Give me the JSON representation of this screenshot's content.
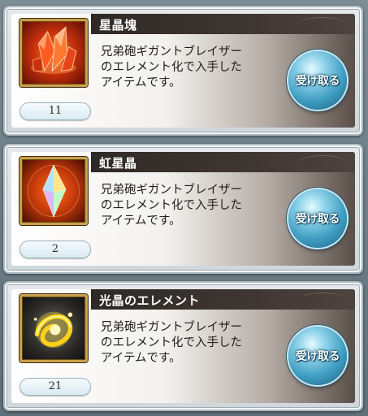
{
  "items": [
    {
      "name": "星晶塊",
      "icon": "red-crystal-cluster-icon",
      "description": [
        "兄弟砲ギガントブレイザー",
        "のエレメント化で入手した",
        "アイテムです。"
      ],
      "count": "11",
      "button": "受け取る"
    },
    {
      "name": "虹星晶",
      "icon": "rainbow-crystal-icon",
      "description": [
        "兄弟砲ギガントブレイザー",
        "のエレメント化で入手した",
        "アイテムです。"
      ],
      "count": "2",
      "button": "受け取る"
    },
    {
      "name": "光晶のエレメント",
      "icon": "light-element-icon",
      "description": [
        "兄弟砲ギガントブレイザー",
        "のエレメント化で入手した",
        "アイテムです。"
      ],
      "count": "21",
      "button": "受け取る"
    }
  ],
  "colors": {
    "title_bar": "#2f2926",
    "button_blue": "#3f9dc2",
    "frame_gold": "#c9a14a"
  }
}
